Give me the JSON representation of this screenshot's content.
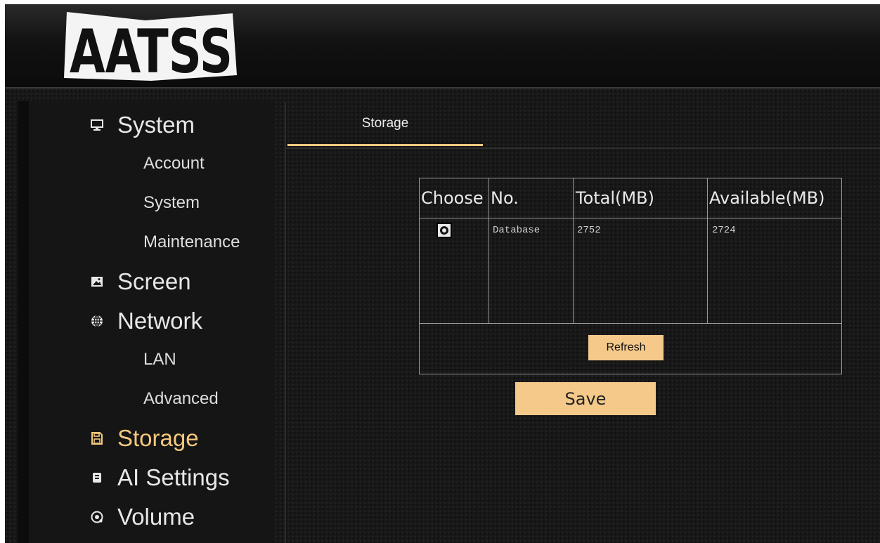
{
  "app": {
    "logo_text": "AATSS"
  },
  "sidebar": {
    "items": [
      {
        "label": "System",
        "icon": "monitor-icon",
        "level": "main"
      },
      {
        "label": "Account",
        "level": "sub"
      },
      {
        "label": "System",
        "level": "sub"
      },
      {
        "label": "Maintenance",
        "level": "sub"
      },
      {
        "label": "Screen",
        "icon": "image-icon",
        "level": "main"
      },
      {
        "label": "Network",
        "icon": "globe-icon",
        "level": "main"
      },
      {
        "label": "LAN",
        "level": "sub"
      },
      {
        "label": "Advanced",
        "level": "sub"
      },
      {
        "label": "Storage",
        "icon": "floppy-disk-icon",
        "level": "main",
        "active": true
      },
      {
        "label": "AI Settings",
        "icon": "chip-icon",
        "level": "main"
      },
      {
        "label": "Volume",
        "icon": "speaker-icon",
        "level": "main"
      }
    ]
  },
  "tabs": [
    {
      "label": "Storage",
      "active": true
    }
  ],
  "storage_table": {
    "headers": [
      "Choose",
      "No.",
      "Total(MB)",
      "Available(MB)"
    ],
    "rows": [
      {
        "selected": true,
        "no": "Database",
        "total": "2752",
        "available": "2724"
      }
    ],
    "refresh_label": "Refresh"
  },
  "save_label": "Save",
  "colors": {
    "accent": "#f5c87e",
    "button_bg": "#f5c98a",
    "background": "#181818",
    "text": "#e8e8e8"
  }
}
